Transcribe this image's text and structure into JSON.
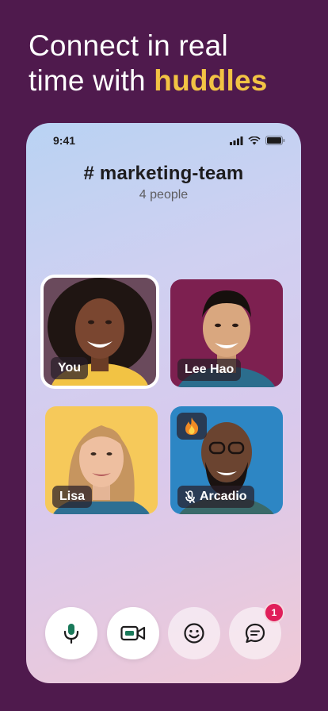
{
  "headline": {
    "line1": "Connect in real",
    "line2_prefix": "time with ",
    "line2_accent": "huddles"
  },
  "status_bar": {
    "time": "9:41",
    "icons": [
      "signal-icon",
      "wifi-icon",
      "battery-icon"
    ]
  },
  "channel": {
    "title": "# marketing-team",
    "subtitle": "4 people"
  },
  "participants": [
    {
      "name": "You",
      "active": true,
      "muted": false
    },
    {
      "name": "Lee Hao",
      "active": false,
      "muted": false
    },
    {
      "name": "Lisa",
      "active": false,
      "muted": false
    },
    {
      "name": "Arcadio",
      "active": false,
      "muted": true,
      "reaction": "fire"
    }
  ],
  "controls": [
    {
      "icon": "microphone-icon"
    },
    {
      "icon": "video-camera-icon"
    },
    {
      "icon": "emoji-icon"
    },
    {
      "icon": "chat-icon",
      "badge": "1"
    }
  ],
  "colors": {
    "background": "#4f1a4d",
    "accent": "#f2c344",
    "badge": "#e01e5a",
    "control_icon": "#1a7a5a"
  }
}
